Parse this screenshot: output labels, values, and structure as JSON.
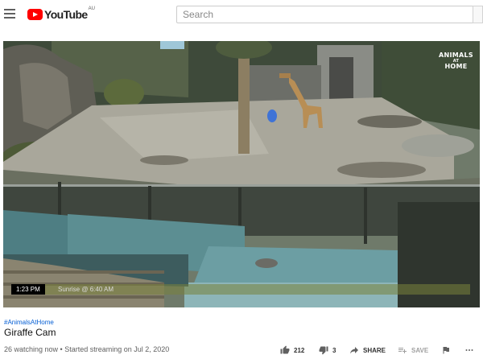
{
  "header": {
    "logo_text": "YouTube",
    "logo_region": "AU",
    "search_placeholder": "Search"
  },
  "player": {
    "watermark_line1": "ANIMALS",
    "watermark_line2": "AT",
    "watermark_line3": "HOME",
    "clock": "1:23 PM",
    "sunrise_text": "Sunrise @ 6:40 AM"
  },
  "video": {
    "hashtag": "#AnimalsAtHome",
    "title": "Giraffe Cam",
    "meta": "26 watching now • Started streaming on Jul 2, 2020"
  },
  "actions": {
    "likes": "212",
    "dislikes": "3",
    "share_label": "SHARE",
    "save_label": "SAVE"
  },
  "icons": {
    "menu": "menu-icon",
    "logo": "youtube-logo-icon",
    "like": "thumbs-up-icon",
    "dislike": "thumbs-down-icon",
    "share": "share-arrow-icon",
    "save": "playlist-add-icon",
    "flag": "flag-icon",
    "more": "more-horizontal-icon"
  }
}
